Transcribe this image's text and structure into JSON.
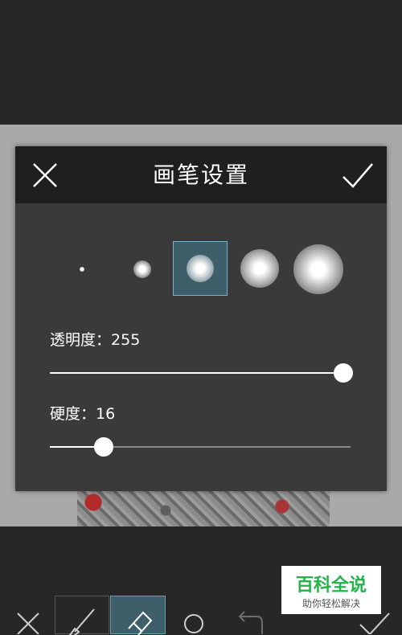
{
  "dialog": {
    "title": "画笔设置",
    "close_icon": "close-icon",
    "confirm_icon": "check-icon",
    "brush_sizes": [
      "tiny",
      "small",
      "medium",
      "large",
      "xlarge"
    ],
    "selected_brush": "medium",
    "opacity_label": "透明度：",
    "opacity_value": "255",
    "opacity_fraction": 1.0,
    "hardness_label": "硬度：",
    "hardness_value": "16",
    "hardness_fraction": 0.18
  },
  "toolbar": {
    "tools": [
      "close-icon",
      "brush-icon",
      "eraser-icon",
      "circle-icon",
      "undo-icon",
      "check-icon"
    ],
    "selected_tool": "eraser-icon"
  },
  "watermark": {
    "title": "百科全说",
    "subtitle": "助你轻松解决"
  },
  "colors": {
    "background": "#272727",
    "canvas": "#a9a9a9",
    "dialog": "#3a3a3a",
    "dialog_header": "#1f1f1f",
    "accent_selected": "#3e5e6a",
    "watermark_green": "#24b24a"
  }
}
